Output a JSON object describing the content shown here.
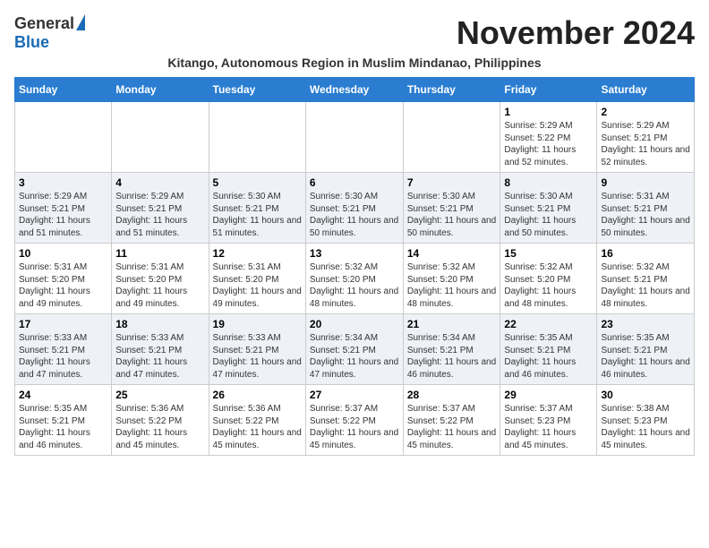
{
  "logo": {
    "general": "General",
    "blue": "Blue"
  },
  "header": {
    "month": "November 2024",
    "subtitle": "Kitango, Autonomous Region in Muslim Mindanao, Philippines"
  },
  "days_of_week": [
    "Sunday",
    "Monday",
    "Tuesday",
    "Wednesday",
    "Thursday",
    "Friday",
    "Saturday"
  ],
  "weeks": [
    [
      {
        "day": "",
        "info": ""
      },
      {
        "day": "",
        "info": ""
      },
      {
        "day": "",
        "info": ""
      },
      {
        "day": "",
        "info": ""
      },
      {
        "day": "",
        "info": ""
      },
      {
        "day": "1",
        "info": "Sunrise: 5:29 AM\nSunset: 5:22 PM\nDaylight: 11 hours and 52 minutes."
      },
      {
        "day": "2",
        "info": "Sunrise: 5:29 AM\nSunset: 5:21 PM\nDaylight: 11 hours and 52 minutes."
      }
    ],
    [
      {
        "day": "3",
        "info": "Sunrise: 5:29 AM\nSunset: 5:21 PM\nDaylight: 11 hours and 51 minutes."
      },
      {
        "day": "4",
        "info": "Sunrise: 5:29 AM\nSunset: 5:21 PM\nDaylight: 11 hours and 51 minutes."
      },
      {
        "day": "5",
        "info": "Sunrise: 5:30 AM\nSunset: 5:21 PM\nDaylight: 11 hours and 51 minutes."
      },
      {
        "day": "6",
        "info": "Sunrise: 5:30 AM\nSunset: 5:21 PM\nDaylight: 11 hours and 50 minutes."
      },
      {
        "day": "7",
        "info": "Sunrise: 5:30 AM\nSunset: 5:21 PM\nDaylight: 11 hours and 50 minutes."
      },
      {
        "day": "8",
        "info": "Sunrise: 5:30 AM\nSunset: 5:21 PM\nDaylight: 11 hours and 50 minutes."
      },
      {
        "day": "9",
        "info": "Sunrise: 5:31 AM\nSunset: 5:21 PM\nDaylight: 11 hours and 50 minutes."
      }
    ],
    [
      {
        "day": "10",
        "info": "Sunrise: 5:31 AM\nSunset: 5:20 PM\nDaylight: 11 hours and 49 minutes."
      },
      {
        "day": "11",
        "info": "Sunrise: 5:31 AM\nSunset: 5:20 PM\nDaylight: 11 hours and 49 minutes."
      },
      {
        "day": "12",
        "info": "Sunrise: 5:31 AM\nSunset: 5:20 PM\nDaylight: 11 hours and 49 minutes."
      },
      {
        "day": "13",
        "info": "Sunrise: 5:32 AM\nSunset: 5:20 PM\nDaylight: 11 hours and 48 minutes."
      },
      {
        "day": "14",
        "info": "Sunrise: 5:32 AM\nSunset: 5:20 PM\nDaylight: 11 hours and 48 minutes."
      },
      {
        "day": "15",
        "info": "Sunrise: 5:32 AM\nSunset: 5:20 PM\nDaylight: 11 hours and 48 minutes."
      },
      {
        "day": "16",
        "info": "Sunrise: 5:32 AM\nSunset: 5:21 PM\nDaylight: 11 hours and 48 minutes."
      }
    ],
    [
      {
        "day": "17",
        "info": "Sunrise: 5:33 AM\nSunset: 5:21 PM\nDaylight: 11 hours and 47 minutes."
      },
      {
        "day": "18",
        "info": "Sunrise: 5:33 AM\nSunset: 5:21 PM\nDaylight: 11 hours and 47 minutes."
      },
      {
        "day": "19",
        "info": "Sunrise: 5:33 AM\nSunset: 5:21 PM\nDaylight: 11 hours and 47 minutes."
      },
      {
        "day": "20",
        "info": "Sunrise: 5:34 AM\nSunset: 5:21 PM\nDaylight: 11 hours and 47 minutes."
      },
      {
        "day": "21",
        "info": "Sunrise: 5:34 AM\nSunset: 5:21 PM\nDaylight: 11 hours and 46 minutes."
      },
      {
        "day": "22",
        "info": "Sunrise: 5:35 AM\nSunset: 5:21 PM\nDaylight: 11 hours and 46 minutes."
      },
      {
        "day": "23",
        "info": "Sunrise: 5:35 AM\nSunset: 5:21 PM\nDaylight: 11 hours and 46 minutes."
      }
    ],
    [
      {
        "day": "24",
        "info": "Sunrise: 5:35 AM\nSunset: 5:21 PM\nDaylight: 11 hours and 46 minutes."
      },
      {
        "day": "25",
        "info": "Sunrise: 5:36 AM\nSunset: 5:22 PM\nDaylight: 11 hours and 45 minutes."
      },
      {
        "day": "26",
        "info": "Sunrise: 5:36 AM\nSunset: 5:22 PM\nDaylight: 11 hours and 45 minutes."
      },
      {
        "day": "27",
        "info": "Sunrise: 5:37 AM\nSunset: 5:22 PM\nDaylight: 11 hours and 45 minutes."
      },
      {
        "day": "28",
        "info": "Sunrise: 5:37 AM\nSunset: 5:22 PM\nDaylight: 11 hours and 45 minutes."
      },
      {
        "day": "29",
        "info": "Sunrise: 5:37 AM\nSunset: 5:23 PM\nDaylight: 11 hours and 45 minutes."
      },
      {
        "day": "30",
        "info": "Sunrise: 5:38 AM\nSunset: 5:23 PM\nDaylight: 11 hours and 45 minutes."
      }
    ]
  ]
}
